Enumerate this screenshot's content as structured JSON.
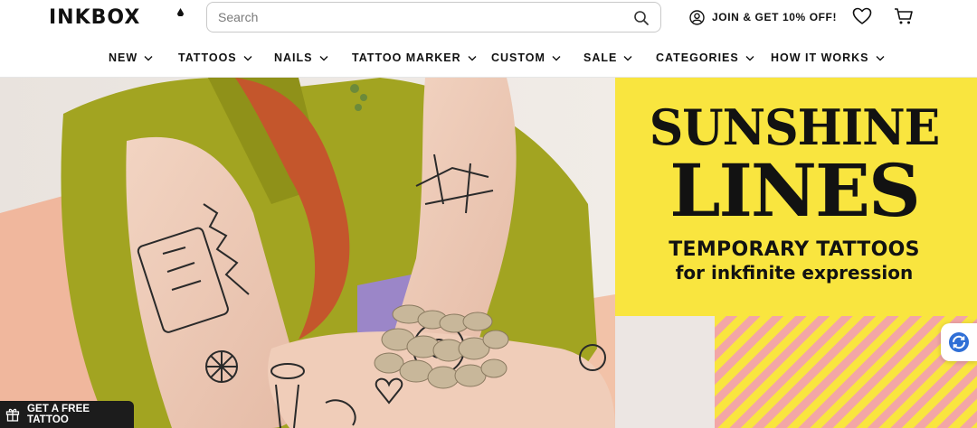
{
  "header": {
    "logo": "INKBOX",
    "search": {
      "placeholder": "Search",
      "value": ""
    },
    "join_label": "JOIN & GET 10% OFF!"
  },
  "nav": {
    "items": [
      {
        "label": "NEW"
      },
      {
        "label": "TATTOOS"
      },
      {
        "label": "NAILS"
      },
      {
        "label": "TATTOO MARKER"
      },
      {
        "label": "CUSTOM"
      },
      {
        "label": "SALE"
      },
      {
        "label": "CATEGORIES"
      },
      {
        "label": "HOW IT WORKS"
      }
    ]
  },
  "hero": {
    "headline_1": "SUNSHINE",
    "headline_2": "LINES",
    "subline_1": "TEMPORARY TATTOOS",
    "subline_2": "for inkfinite expression",
    "banner_color": "#f9e53f",
    "stripe_color": "#f3a6a6"
  },
  "promo": {
    "free_tattoo_label": "GET A FREE TATTOO"
  },
  "icons": {
    "search": "search-icon",
    "account": "user-circle-icon",
    "wishlist": "heart-icon",
    "cart": "cart-icon",
    "gift": "gift-icon",
    "translate": "translate-icon"
  }
}
